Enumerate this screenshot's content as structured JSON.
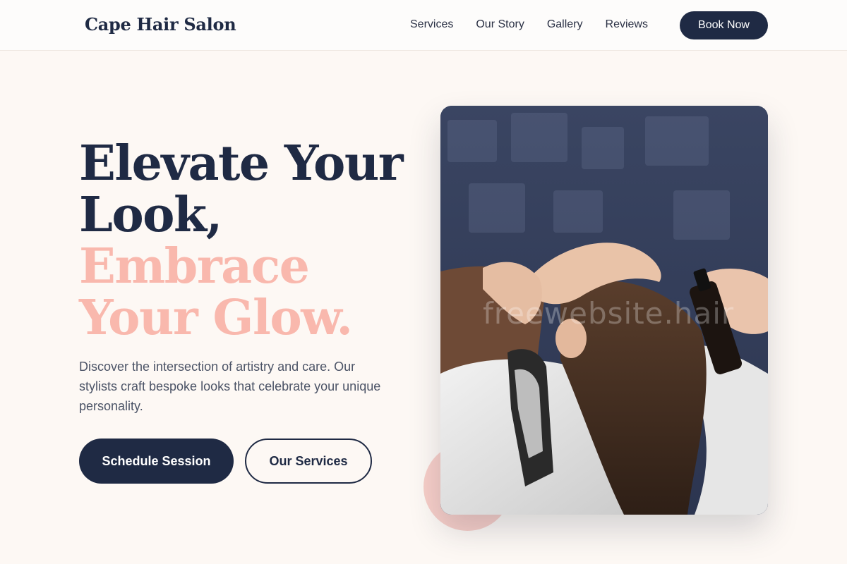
{
  "header": {
    "logo": "Cape Hair Salon",
    "nav": [
      {
        "label": "Services"
      },
      {
        "label": "Our Story"
      },
      {
        "label": "Gallery"
      },
      {
        "label": "Reviews"
      }
    ],
    "cta_label": "Book Now"
  },
  "hero": {
    "headline_line1": "Elevate Your",
    "headline_line2": "Look,",
    "accent_line1": "Embrace",
    "accent_line2": "Your Glow.",
    "description": "Discover the intersection of artistry and care. Our stylists craft bespoke looks that celebrate your unique personality.",
    "primary_button": "Schedule Session",
    "secondary_button": "Our Services",
    "image_watermark": "freewebsite.hair"
  },
  "colors": {
    "navy": "#1f2a44",
    "accent_pink": "#f9b8ad",
    "background": "#fdf8f4"
  }
}
